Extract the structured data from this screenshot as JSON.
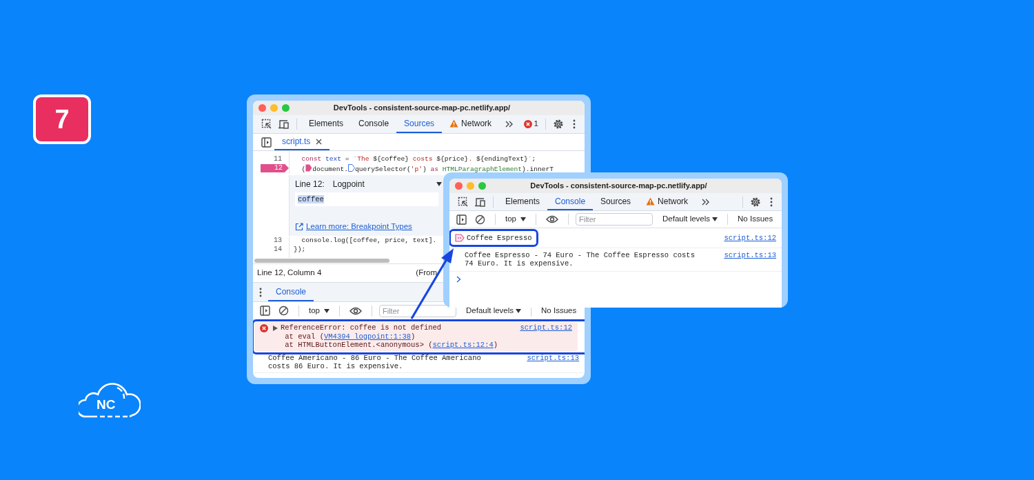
{
  "step_badge": "7",
  "logo": {
    "text": "NC"
  },
  "sources_window": {
    "title": "DevTools - consistent-source-map-pc.netlify.app/",
    "tabs": [
      {
        "label": "Elements",
        "selected": false,
        "warning": false
      },
      {
        "label": "Console",
        "selected": false,
        "warning": false
      },
      {
        "label": "Sources",
        "selected": true,
        "warning": false
      },
      {
        "label": "Network",
        "selected": false,
        "warning": true
      }
    ],
    "error_count": "1",
    "file_tabs": [
      {
        "label": "script.ts",
        "selected": true
      }
    ],
    "code_lines": [
      {
        "number": "11",
        "logpoint": false,
        "parts": [
          {
            "kind": "keyword",
            "text": "  const "
          },
          {
            "kind": "variable",
            "text": "text"
          },
          {
            "kind": "plain",
            "text": " = "
          },
          {
            "kind": "string",
            "text": "`The "
          },
          {
            "kind": "plain",
            "text": "${coffee}"
          },
          {
            "kind": "string",
            "text": " costs "
          },
          {
            "kind": "plain",
            "text": "${price}"
          },
          {
            "kind": "string",
            "text": ". "
          },
          {
            "kind": "plain",
            "text": "${endingText}"
          },
          {
            "kind": "string",
            "text": "`"
          },
          {
            "kind": "plain",
            "text": ";"
          }
        ]
      },
      {
        "number": "12",
        "logpoint": true,
        "parts": [
          {
            "kind": "plain",
            "text": "  ("
          },
          {
            "kind": "marker",
            "active": true
          },
          {
            "kind": "plain",
            "text": "document."
          },
          {
            "kind": "marker",
            "active": false
          },
          {
            "kind": "plain",
            "text": "querySelector("
          },
          {
            "kind": "string",
            "text": "'p'"
          },
          {
            "kind": "plain",
            "text": ") "
          },
          {
            "kind": "keyword",
            "text": "as "
          },
          {
            "kind": "type",
            "text": "HTMLParagraphElement"
          },
          {
            "kind": "plain",
            "text": ").innerT"
          }
        ]
      },
      {
        "number": "13",
        "logpoint": false,
        "parts": [
          {
            "kind": "plain",
            "text": "  console.log([coffee, price, text]."
          }
        ]
      },
      {
        "number": "14",
        "logpoint": false,
        "parts": [
          {
            "kind": "plain",
            "text": "});"
          }
        ]
      }
    ],
    "logpoint_editor": {
      "line_label": "Line 12:",
      "type": "Logpoint",
      "expression": "coffee",
      "link": "Learn more: Breakpoint Types"
    },
    "status_bar": {
      "position": "Line 12, Column 4",
      "source": "(From"
    },
    "drawer_tabs": [
      {
        "label": "Console",
        "selected": true
      }
    ],
    "console_toolbar": {
      "context": "top",
      "filter_placeholder": "Filter",
      "levels": "Default levels",
      "issues": "No Issues"
    },
    "messages": [
      {
        "kind": "error",
        "text": "ReferenceError: coffee is not defined",
        "source": "script.ts:12",
        "highlighted": true,
        "stack": [
          {
            "prefix": "at eval (",
            "link": "VM4394 logpoint:1:38",
            "suffix": ")"
          },
          {
            "prefix": "at HTMLButtonElement.<anonymous> (",
            "link": "script.ts:12:4",
            "suffix": ")"
          }
        ]
      },
      {
        "kind": "log",
        "text": "Coffee Americano - 86 Euro - The Coffee Americano costs 86 Euro. It is expensive.",
        "source": "script.ts:13",
        "highlighted": false
      }
    ]
  },
  "console_window": {
    "title": "DevTools - consistent-source-map-pc.netlify.app/",
    "tabs": [
      {
        "label": "Elements",
        "selected": false,
        "warning": false
      },
      {
        "label": "Console",
        "selected": true,
        "warning": false
      },
      {
        "label": "Sources",
        "selected": false,
        "warning": false
      },
      {
        "label": "Network",
        "selected": false,
        "warning": true
      }
    ],
    "console_toolbar": {
      "context": "top",
      "filter_placeholder": "Filter",
      "levels": "Default levels",
      "issues": "No Issues"
    },
    "messages": [
      {
        "kind": "logpoint",
        "text": "Coffee Espresso",
        "source": "script.ts:12",
        "highlighted": true
      },
      {
        "kind": "log",
        "text": "Coffee Espresso - 74 Euro - The Coffee Espresso costs 74 Euro. It is expensive.",
        "source": "script.ts:13",
        "highlighted": false
      }
    ]
  }
}
